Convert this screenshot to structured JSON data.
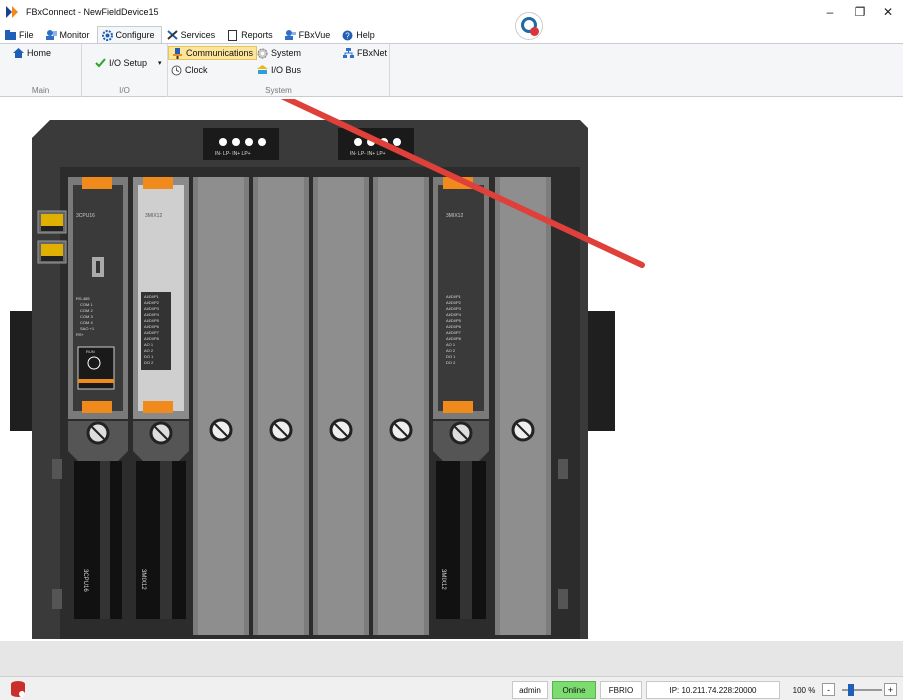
{
  "window": {
    "title": "FBxConnect - NewFieldDevice15",
    "minimize": "–",
    "maximize": "❐",
    "close": "✕"
  },
  "menu": {
    "tabs": [
      {
        "label": "File",
        "icon": "folder-icon"
      },
      {
        "label": "Monitor",
        "icon": "monitor-icon"
      },
      {
        "label": "Configure",
        "icon": "gear-icon"
      },
      {
        "label": "Services",
        "icon": "tools-icon"
      },
      {
        "label": "Reports",
        "icon": "document-icon"
      },
      {
        "label": "FBxVue",
        "icon": "user-icon"
      },
      {
        "label": "Help",
        "icon": "help-icon"
      }
    ],
    "active": "Configure"
  },
  "ribbon": {
    "groups": {
      "main": {
        "label": "Main",
        "home": "Home"
      },
      "io": {
        "label": "I/O",
        "io_setup": "I/O Setup"
      },
      "system": {
        "label": "System",
        "communications": "Communications",
        "clock": "Clock",
        "system": "System",
        "io_bus": "I/O Bus",
        "fbxnet": "FBxNet"
      }
    }
  },
  "rack": {
    "connectors": [
      {
        "pins": "IN-  LP-  IN+  LP+"
      },
      {
        "pins": "IN-  LP-  IN+  LP+"
      }
    ],
    "modules": [
      {
        "name": "3CPU16",
        "label_bottom": "3CPU16",
        "ports": [
          "RS-485",
          "COM 1",
          "COM 2",
          "COM 3",
          "COM 4",
          "SAO +1",
          "RS+"
        ],
        "status": "RUN"
      },
      {
        "name": "3MIX12",
        "label_bottom": "3MIX12",
        "channels": [
          "AI/DI/P1",
          "AI/DI/P2",
          "AI/DI/P3",
          "AI/DI/P4",
          "AI/DI/P5",
          "AI/DI/P6",
          "AI/DI/P7",
          "AI/DI/P8",
          "AO 1",
          "AO 2",
          "DO 1",
          "DO 2"
        ]
      },
      {
        "name": "3MIX12",
        "label_bottom": "3MIX12",
        "channels": [
          "AI/DI/P1",
          "AI/DI/P2",
          "AI/DI/P3",
          "AI/DI/P4",
          "AI/DI/P5",
          "AI/DI/P6",
          "AI/DI/P7",
          "AI/DI/P8",
          "AO 1",
          "AO 2",
          "DO 1",
          "DO 2"
        ]
      }
    ]
  },
  "status": {
    "user": "admin",
    "connection": "Online",
    "device": "FBRIO",
    "ip": "IP: 10.211.74.228:20000",
    "zoom": "100 %",
    "zoom_out": "-",
    "zoom_in": "+"
  },
  "colors": {
    "accent_orange": "#f08a1c",
    "online_green": "#7cdc6f",
    "arrow_red": "#e0403a",
    "highlight": "#fde59b"
  }
}
